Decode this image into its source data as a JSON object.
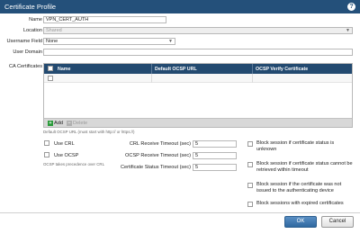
{
  "window": {
    "title": "Certificate Profile",
    "help_icon": "?"
  },
  "form": {
    "name_label": "Name",
    "name_value": "VPN_CERT_AUTH",
    "location_label": "Location",
    "location_value": "Shared",
    "username_label": "Username Field",
    "username_value": "None",
    "user_domain_label": "User Domain",
    "user_domain_value": "",
    "ca_label": "CA Certificates"
  },
  "grid": {
    "columns": [
      "Name",
      "Default OCSP URL",
      "OCSP Verify Certificate"
    ],
    "add_label": "Add",
    "delete_label": "Delete"
  },
  "options": {
    "ocsp_url_hint": "Default OCSP URL (must start with http:// or https://)",
    "use_crl_label": "Use CRL",
    "use_ocsp_label": "Use OCSP",
    "ocsp_precedence_hint": "OCSP takes precedence over CRL"
  },
  "timeouts": [
    {
      "label": "CRL Receive Timeout (sec)",
      "value": "5"
    },
    {
      "label": "OCSP Receive Timeout (sec)",
      "value": "5"
    },
    {
      "label": "Certificate Status Timeout (sec)",
      "value": "5"
    }
  ],
  "block_options": [
    {
      "line1": "Block session if certificate status is",
      "line2": "unknown"
    },
    {
      "line1": "Block session if certificate status cannot be",
      "line2": "retrieved within timeout"
    },
    {
      "line1": "Block session if the certificate was not",
      "line2": "issued to the authenticating device"
    },
    {
      "line1": "Block sessions with expired certificates",
      "line2": ""
    }
  ],
  "buttons": {
    "ok": "OK",
    "cancel": "Cancel"
  },
  "colors": {
    "titlebar": "#24507a",
    "grid_header": "#234a70",
    "primary_button": "#2f68a0"
  }
}
